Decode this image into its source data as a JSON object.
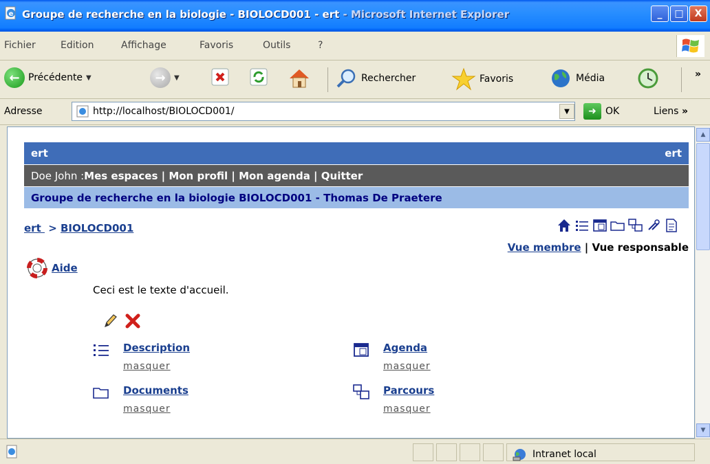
{
  "window": {
    "title_main": "Groupe de recherche en la biologie - BIOLOCD001 - ert",
    "title_app": " - Microsoft Internet Explorer",
    "btn_min": "_",
    "btn_max": "□",
    "btn_close": "X"
  },
  "menu": {
    "items": [
      "Fichier",
      "Edition",
      "Affichage",
      "Favoris",
      "Outils",
      "?"
    ]
  },
  "toolbar": {
    "back_label": "Précédente",
    "search_label": "Rechercher",
    "favorites_label": "Favoris",
    "media_label": "Média",
    "more": "»"
  },
  "address": {
    "label": "Adresse",
    "url": "http://localhost/BIOLOCD001/",
    "go_label": "OK",
    "links_label": "Liens",
    "links_more": "»"
  },
  "page": {
    "course_code": "ert",
    "course_code_right": "ert",
    "user_name": "Doe John : ",
    "nav": {
      "my_spaces": "Mes espaces",
      "sep1": " | ",
      "my_profile": "Mon profil",
      "sep2": " | ",
      "my_agenda": "Mon agenda",
      "sep3": " | ",
      "quit": "Quitter"
    },
    "course_title": "Groupe de recherche en la biologie BIOLOCD001 - Thomas De Praetere",
    "breadcrumb": {
      "root": "ert ",
      "sep": " > ",
      "current": "BIOLOCD001"
    },
    "views": {
      "member": "Vue membre",
      "sep": " | ",
      "manager": "Vue responsable"
    },
    "help_label": "Aide",
    "welcome_text": "Ceci est le texte d'accueil.",
    "tools": [
      {
        "name": "Description",
        "hide": "masquer"
      },
      {
        "name": "Agenda",
        "hide": "masquer"
      },
      {
        "name": "Documents",
        "hide": "masquer"
      },
      {
        "name": "Parcours",
        "hide": "masquer"
      }
    ]
  },
  "status": {
    "zone": "Intranet local"
  }
}
